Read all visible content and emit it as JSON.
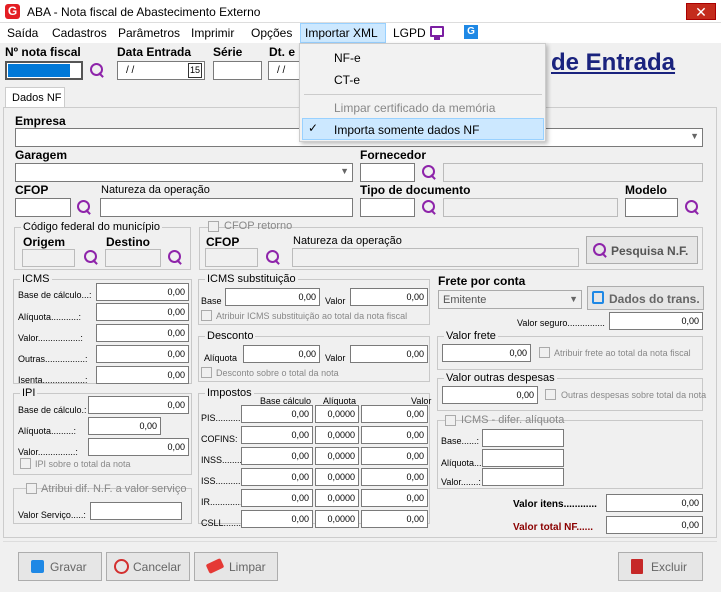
{
  "window": {
    "title": "ABA - Nota fiscal de Abastecimento Externo",
    "app_icon": "G",
    "close": "✕"
  },
  "menu": {
    "items": [
      "Saída",
      "Cadastros",
      "Parâmetros",
      "Imprimir",
      "Opções",
      "Importar XML",
      "LGPD"
    ]
  },
  "dropdown": {
    "items": [
      "NF-e",
      "CT-e",
      "Limpar certificado da memória",
      "Importa somente dados NF"
    ],
    "checked": "✓"
  },
  "header": {
    "numero_label": "Nº nota fiscal",
    "data_label": "Data Entrada",
    "data_value": "/ /",
    "serie_label": "Série",
    "dt_label": "Dt. e",
    "dt_value": "/ /",
    "cal_label": "15",
    "page_title": "de Entrada"
  },
  "tab": {
    "label": "Dados NF"
  },
  "labels": {
    "empresa": "Empresa",
    "garagem": "Garagem",
    "fornecedor": "Fornecedor",
    "cfop": "CFOP",
    "natureza": "Natureza da operação",
    "tipo_doc": "Tipo de documento",
    "modelo": "Modelo",
    "cod_municipio": "Código federal do município",
    "origem": "Origem",
    "destino": "Destino",
    "cfop_retorno": "CFOP retorno",
    "cfop2": "CFOP",
    "natureza2": "Natureza da operação",
    "pesquisa_nf": "Pesquisa N.F."
  },
  "icms": {
    "title": "ICMS",
    "rows": [
      {
        "l": "Base de cálculo...:",
        "v": "0,00"
      },
      {
        "l": "Alíquota...........:",
        "v": "0,00"
      },
      {
        "l": "Valor.................:",
        "v": "0,00"
      },
      {
        "l": "Outras................:",
        "v": "0,00"
      },
      {
        "l": "Isenta.................:",
        "v": "0,00"
      }
    ]
  },
  "ipi": {
    "title": "IPI",
    "rows": [
      {
        "l": "Base de cálculo.:",
        "v": "0,00"
      },
      {
        "l": "Alíquota.........:",
        "v": "0,00"
      },
      {
        "l": "Valor...............:",
        "v": "0,00"
      }
    ],
    "check": "IPI sobre o total da nota"
  },
  "icms_sub": {
    "title": "ICMS substituição",
    "base_label": "Base",
    "base": "0,00",
    "valor_label": "Valor",
    "valor": "0,00",
    "check": "Atribuir ICMS substituição ao total da nota fiscal"
  },
  "desconto": {
    "title": "Desconto",
    "aliq_label": "Alíquota",
    "aliq": "0,00",
    "valor_label": "Valor",
    "valor": "0,00",
    "check": "Desconto sobre o total da nota"
  },
  "impostos": {
    "title": "Impostos",
    "h1": "Base cálculo",
    "h2": "Alíquota",
    "h3": "Valor",
    "rows": [
      {
        "l": "PIS...........",
        "b": "0,00",
        "a": "0,0000",
        "v": "0,00"
      },
      {
        "l": "COFINS:",
        "b": "0,00",
        "a": "0,0000",
        "v": "0,00"
      },
      {
        "l": "INSS.........",
        "b": "0,00",
        "a": "0,0000",
        "v": "0,00"
      },
      {
        "l": "ISS............",
        "b": "0,00",
        "a": "0,0000",
        "v": "0,00"
      },
      {
        "l": "IR..............",
        "b": "0,00",
        "a": "0,0000",
        "v": "0,00"
      },
      {
        "l": "CSLL.........",
        "b": "0,00",
        "a": "0,0000",
        "v": "0,00"
      }
    ]
  },
  "atribuir": {
    "check": "Atribui dif. N.F. a valor serviço",
    "valor_label": "Valor Serviço.....:"
  },
  "frete": {
    "title": "Frete por conta",
    "select": "Emitente",
    "dados_btn": "Dados do trans.",
    "seguro_label": "Valor seguro...............",
    "seguro": "0,00",
    "valor_frete_title": "Valor frete",
    "valor_frete": "0,00",
    "frete_check": "Atribuir frete ao total da nota fiscal",
    "outras_title": "Valor outras despesas",
    "outras": "0,00",
    "outras_check": "Outras despesas sobre total da nota"
  },
  "icms_dif": {
    "title": "ICMS - difer. alíquota",
    "base": "Base......:",
    "aliq": "Alíquota......",
    "valor": "Valor.......:"
  },
  "totais": {
    "itens_label": "Valor itens............",
    "itens": "0,00",
    "total_label": "Valor total NF......",
    "total": "0,00"
  },
  "buttons": {
    "gravar": "Gravar",
    "cancelar": "Cancelar",
    "limpar": "Limpar",
    "excluir": "Excluir"
  }
}
